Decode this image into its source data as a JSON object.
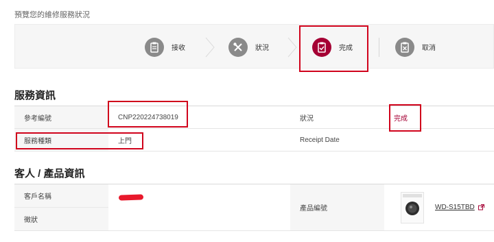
{
  "page": {
    "subtitle": "預覽您的維修服務狀況"
  },
  "steps": [
    {
      "label": "接收",
      "icon": "clipboard-icon",
      "active": false
    },
    {
      "label": "狀況",
      "icon": "tools-icon",
      "active": false
    },
    {
      "label": "完成",
      "icon": "check-clipboard-icon",
      "active": true
    },
    {
      "label": "取消",
      "icon": "cancel-clipboard-icon",
      "active": false
    }
  ],
  "service_info": {
    "title": "服務資訊",
    "ref_label": "參考編號",
    "ref_value": "CNP220224738019",
    "status_label": "狀況",
    "status_value": "完成",
    "type_label": "服務種類",
    "type_value": "上門",
    "receipt_label": "Receipt Date",
    "receipt_value": ""
  },
  "customer_info": {
    "title": "客人 / 產品資訊",
    "name_label": "客戶名稱",
    "symptom_label": "徵狀",
    "product_label": "產品編號",
    "product_model": "WD-S15TBD",
    "product_icon": "washing-machine-icon",
    "external_icon": "external-link-icon"
  },
  "colors": {
    "accent": "#a50034",
    "highlight": "#d0021b",
    "icon_gray": "#8a8a8a"
  }
}
